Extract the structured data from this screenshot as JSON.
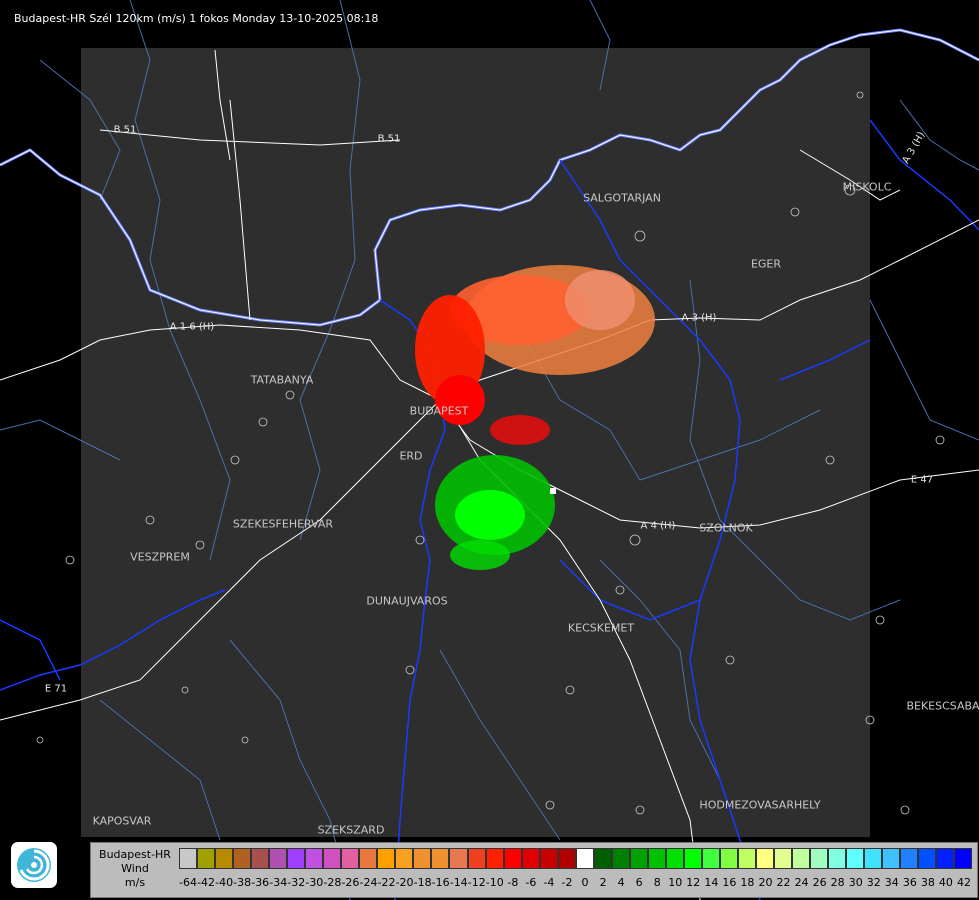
{
  "title": "Budapest-HR Szél 120km (m/s) 1 fokos Monday 13-10-2025 08:18",
  "cities": [
    {
      "name": "SALGOTARJAN"
    },
    {
      "name": "EGER"
    },
    {
      "name": "MISKOLC"
    },
    {
      "name": "TATABANYA"
    },
    {
      "name": "BUDAPEST"
    },
    {
      "name": "ERD"
    },
    {
      "name": "SZEKESFEHERVAR"
    },
    {
      "name": "VESZPREM"
    },
    {
      "name": "DUNAUJVAROS"
    },
    {
      "name": "KECSKEMET"
    },
    {
      "name": "SZOLNOK"
    },
    {
      "name": "BEKESCSABA"
    },
    {
      "name": "HODMEZOVASARHELY"
    },
    {
      "name": "KAPOSVAR"
    },
    {
      "name": "SZEKSZARD"
    }
  ],
  "roads": [
    {
      "name": "B 51"
    },
    {
      "name": "B 51"
    },
    {
      "name": "A 3 (H)"
    },
    {
      "name": "A 3 (H)"
    },
    {
      "name": "A 1 6 (H)"
    },
    {
      "name": "A 4 (H)"
    },
    {
      "name": "E 47"
    },
    {
      "name": "E 71"
    }
  ],
  "legend": {
    "title_line1": "Budapest-HR",
    "title_line2": "Wind",
    "title_line3": "m/s",
    "ticks": [
      "-64",
      "-42",
      "-40",
      "-38",
      "-36",
      "-34",
      "-32",
      "-30",
      "-28",
      "-26",
      "-24",
      "-22",
      "-20",
      "-18",
      "-16",
      "-14",
      "-12",
      "-10",
      "-8",
      "-6",
      "-4",
      "-2",
      "0",
      "2",
      "4",
      "6",
      "8",
      "10",
      "12",
      "14",
      "16",
      "18",
      "20",
      "22",
      "24",
      "26",
      "28",
      "30",
      "32",
      "34",
      "36",
      "38",
      "40",
      "42"
    ],
    "colors": [
      "#c8c8c8",
      "#a0a000",
      "#b88a00",
      "#b06020",
      "#a85050",
      "#b050b0",
      "#a040ff",
      "#c050e0",
      "#d050c0",
      "#e060a0",
      "#e87840",
      "#ffa000",
      "#f8a020",
      "#f09030",
      "#f09030",
      "#e87850",
      "#f04020",
      "#ff2000",
      "#ff0000",
      "#e00000",
      "#c80000",
      "#b00000",
      "#ffffff",
      "#006000",
      "#008000",
      "#00a000",
      "#00c000",
      "#00e000",
      "#00ff00",
      "#40ff40",
      "#80ff40",
      "#c0ff60",
      "#ffff80",
      "#e0ff90",
      "#c0ffa0",
      "#a0ffc0",
      "#80ffe0",
      "#60ffff",
      "#40e0ff",
      "#40c0ff",
      "#2080ff",
      "#0050ff",
      "#0020ff",
      "#0000ff"
    ]
  }
}
